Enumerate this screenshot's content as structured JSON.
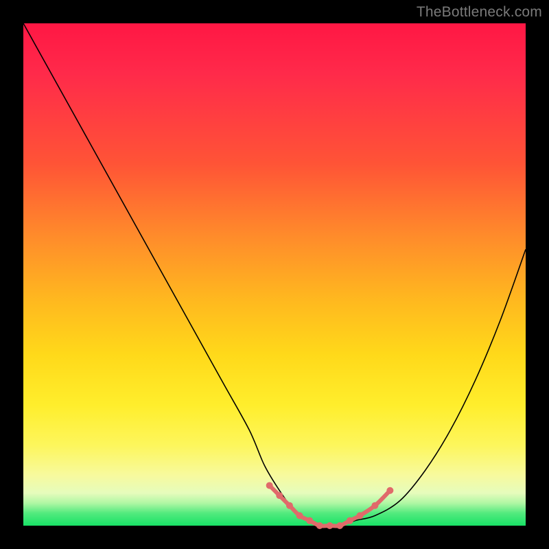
{
  "watermark": "TheBottleneck.com",
  "chart_data": {
    "type": "line",
    "title": "",
    "xlabel": "",
    "ylabel": "",
    "xlim": [
      0,
      100
    ],
    "ylim": [
      0,
      100
    ],
    "grid": false,
    "legend": false,
    "background_gradient": {
      "stops": [
        {
          "pct": 0,
          "color": "#ff1744"
        },
        {
          "pct": 10,
          "color": "#ff2a4a"
        },
        {
          "pct": 28,
          "color": "#ff5436"
        },
        {
          "pct": 42,
          "color": "#ff8a2b"
        },
        {
          "pct": 55,
          "color": "#ffb81f"
        },
        {
          "pct": 66,
          "color": "#ffd91a"
        },
        {
          "pct": 76,
          "color": "#ffee2c"
        },
        {
          "pct": 84,
          "color": "#fdf65c"
        },
        {
          "pct": 90,
          "color": "#f7fa9e"
        },
        {
          "pct": 93.5,
          "color": "#e6fcbc"
        },
        {
          "pct": 95.5,
          "color": "#b0f7a4"
        },
        {
          "pct": 97.5,
          "color": "#53ea7e"
        },
        {
          "pct": 100,
          "color": "#18e266"
        }
      ]
    },
    "series": [
      {
        "name": "bottleneck-curve",
        "color": "#000000",
        "x": [
          0,
          5,
          10,
          15,
          20,
          25,
          30,
          35,
          40,
          45,
          48,
          51,
          54,
          57,
          60,
          63,
          66,
          70,
          75,
          80,
          85,
          90,
          95,
          100
        ],
        "y": [
          100,
          91,
          82,
          73,
          64,
          55,
          46,
          37,
          28,
          19,
          12,
          7,
          3,
          1,
          0,
          0,
          1,
          2,
          5,
          11,
          19,
          29,
          41,
          55
        ]
      },
      {
        "name": "highlight-flat",
        "color": "#e06a6a",
        "x": [
          49,
          51,
          53,
          55,
          57,
          59,
          61,
          63,
          65,
          67,
          70,
          73
        ],
        "y": [
          8,
          6,
          4,
          2,
          1,
          0,
          0,
          0,
          1,
          2,
          4,
          7
        ]
      }
    ],
    "markers": {
      "series": "highlight-flat",
      "x": [
        49,
        51,
        53,
        55,
        57,
        59,
        61,
        63,
        65,
        67,
        70,
        73
      ],
      "y": [
        8,
        6,
        4,
        2,
        1,
        0,
        0,
        0,
        1,
        2,
        4,
        7
      ],
      "radius": 5,
      "color": "#e06a6a"
    }
  }
}
